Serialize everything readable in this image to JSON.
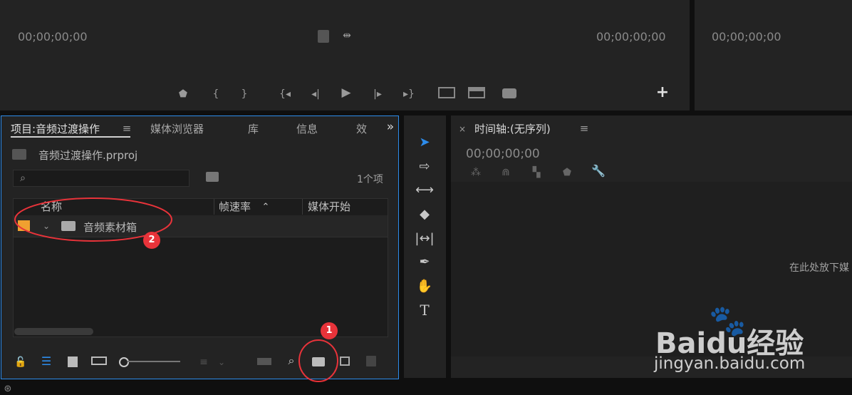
{
  "source_monitor": {
    "timecode_in": "00;00;00;00",
    "timecode_out": "00;00;00;00"
  },
  "program_monitor": {
    "timecode": "00;00;00;00"
  },
  "project_panel": {
    "tabs": [
      "项目:音频过渡操作",
      "媒体浏览器",
      "库",
      "信息",
      "效"
    ],
    "project_file": "音频过渡操作.prproj",
    "search_placeholder": "",
    "item_count": "1个项",
    "columns": [
      "名称",
      "帧速率",
      "媒体开始"
    ],
    "rows": [
      {
        "name": "音频素材箱",
        "color": "#f0a030"
      }
    ]
  },
  "timeline_panel": {
    "title": "时间轴:(无序列)",
    "timecode": "00;00;00;00",
    "drop_hint": "在此处放下媒"
  },
  "annotations": {
    "badge_1": "1",
    "badge_2": "2"
  },
  "watermark": {
    "brand": "Baidu经验",
    "url": "jingyan.baidu.com"
  },
  "colors": {
    "accent": "#2d8ceb",
    "annotation": "#e8333a",
    "lock_green": "#3bb54a"
  }
}
